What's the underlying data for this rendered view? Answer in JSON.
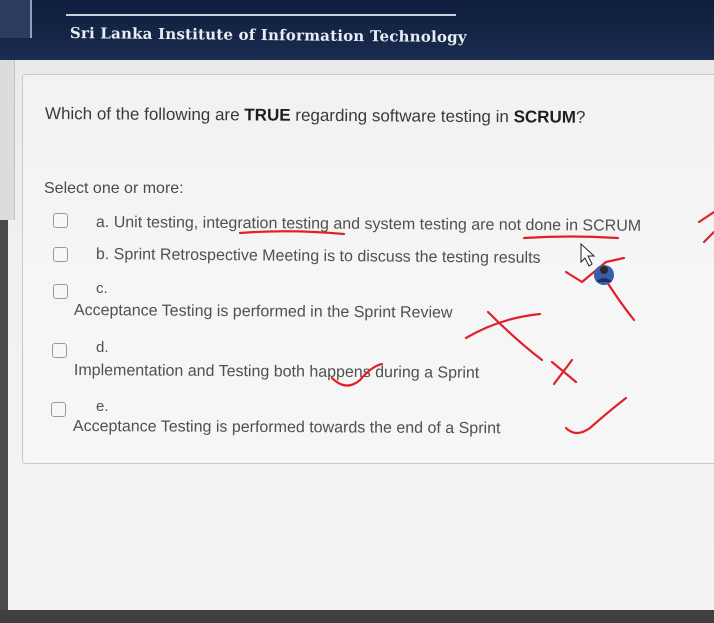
{
  "header": {
    "institute_name": "Sri Lanka Institute of Information Technology"
  },
  "question": {
    "text_before": "Which of the following are ",
    "bold1": "TRUE",
    "text_middle": " regarding software testing in ",
    "bold2": "SCRUM",
    "text_after": "?",
    "prompt": "Select one or more:"
  },
  "options": [
    {
      "letter": "a.",
      "text": "Unit testing, integration testing and system testing are not done in SCRUM"
    },
    {
      "letter": "b.",
      "text": "Sprint Retrospective Meeting is to discuss the testing results"
    },
    {
      "letter": "c.",
      "text": "Acceptance Testing is performed in the Sprint Review"
    },
    {
      "letter": "d.",
      "text": "Implementation and Testing both happens during a Sprint"
    },
    {
      "letter": "e.",
      "text": "Acceptance Testing is performed towards the end of a Sprint"
    }
  ],
  "colors": {
    "annotation_ink": "#e0202a",
    "banner": "#17284a"
  }
}
